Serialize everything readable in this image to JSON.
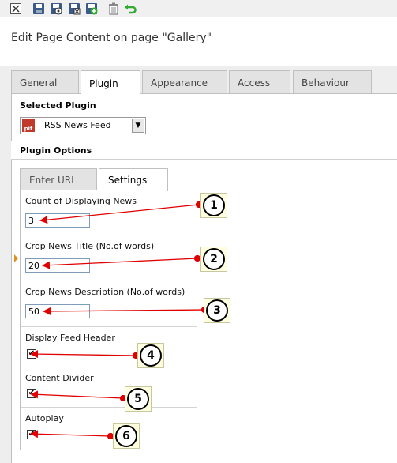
{
  "toolbar": {
    "icons": [
      "close-icon",
      "save-icon",
      "save-view-icon",
      "save-close-icon",
      "save-new-icon",
      "delete-icon",
      "undo-icon"
    ]
  },
  "page_title": "Edit Page Content on page \"Gallery\"",
  "tabs": [
    {
      "label": "General"
    },
    {
      "label": "Plugin"
    },
    {
      "label": "Appearance"
    },
    {
      "label": "Access"
    },
    {
      "label": "Behaviour"
    }
  ],
  "selected_plugin": {
    "label": "Selected Plugin",
    "value": "RSS News Feed",
    "badge": "pit"
  },
  "plugin_options": {
    "label": "Plugin Options",
    "tabs": [
      {
        "label": "Enter URL"
      },
      {
        "label": "Settings"
      }
    ],
    "fields": [
      {
        "label": "Count of Displaying News",
        "value": "3"
      },
      {
        "label": "Crop News Title (No.of words)",
        "value": "20"
      },
      {
        "label": "Crop News Description (No.of words)",
        "value": "50"
      },
      {
        "label": "Display Feed Header",
        "checked": true
      },
      {
        "label": "Content Divider",
        "checked": true
      },
      {
        "label": "Autoplay",
        "checked": true
      }
    ]
  },
  "callouts": [
    "1",
    "2",
    "3",
    "4",
    "5",
    "6"
  ],
  "colors": {
    "annotation_red": "#e00000",
    "tab_border": "#c0c0c0",
    "background_gray": "#eeeeee"
  }
}
